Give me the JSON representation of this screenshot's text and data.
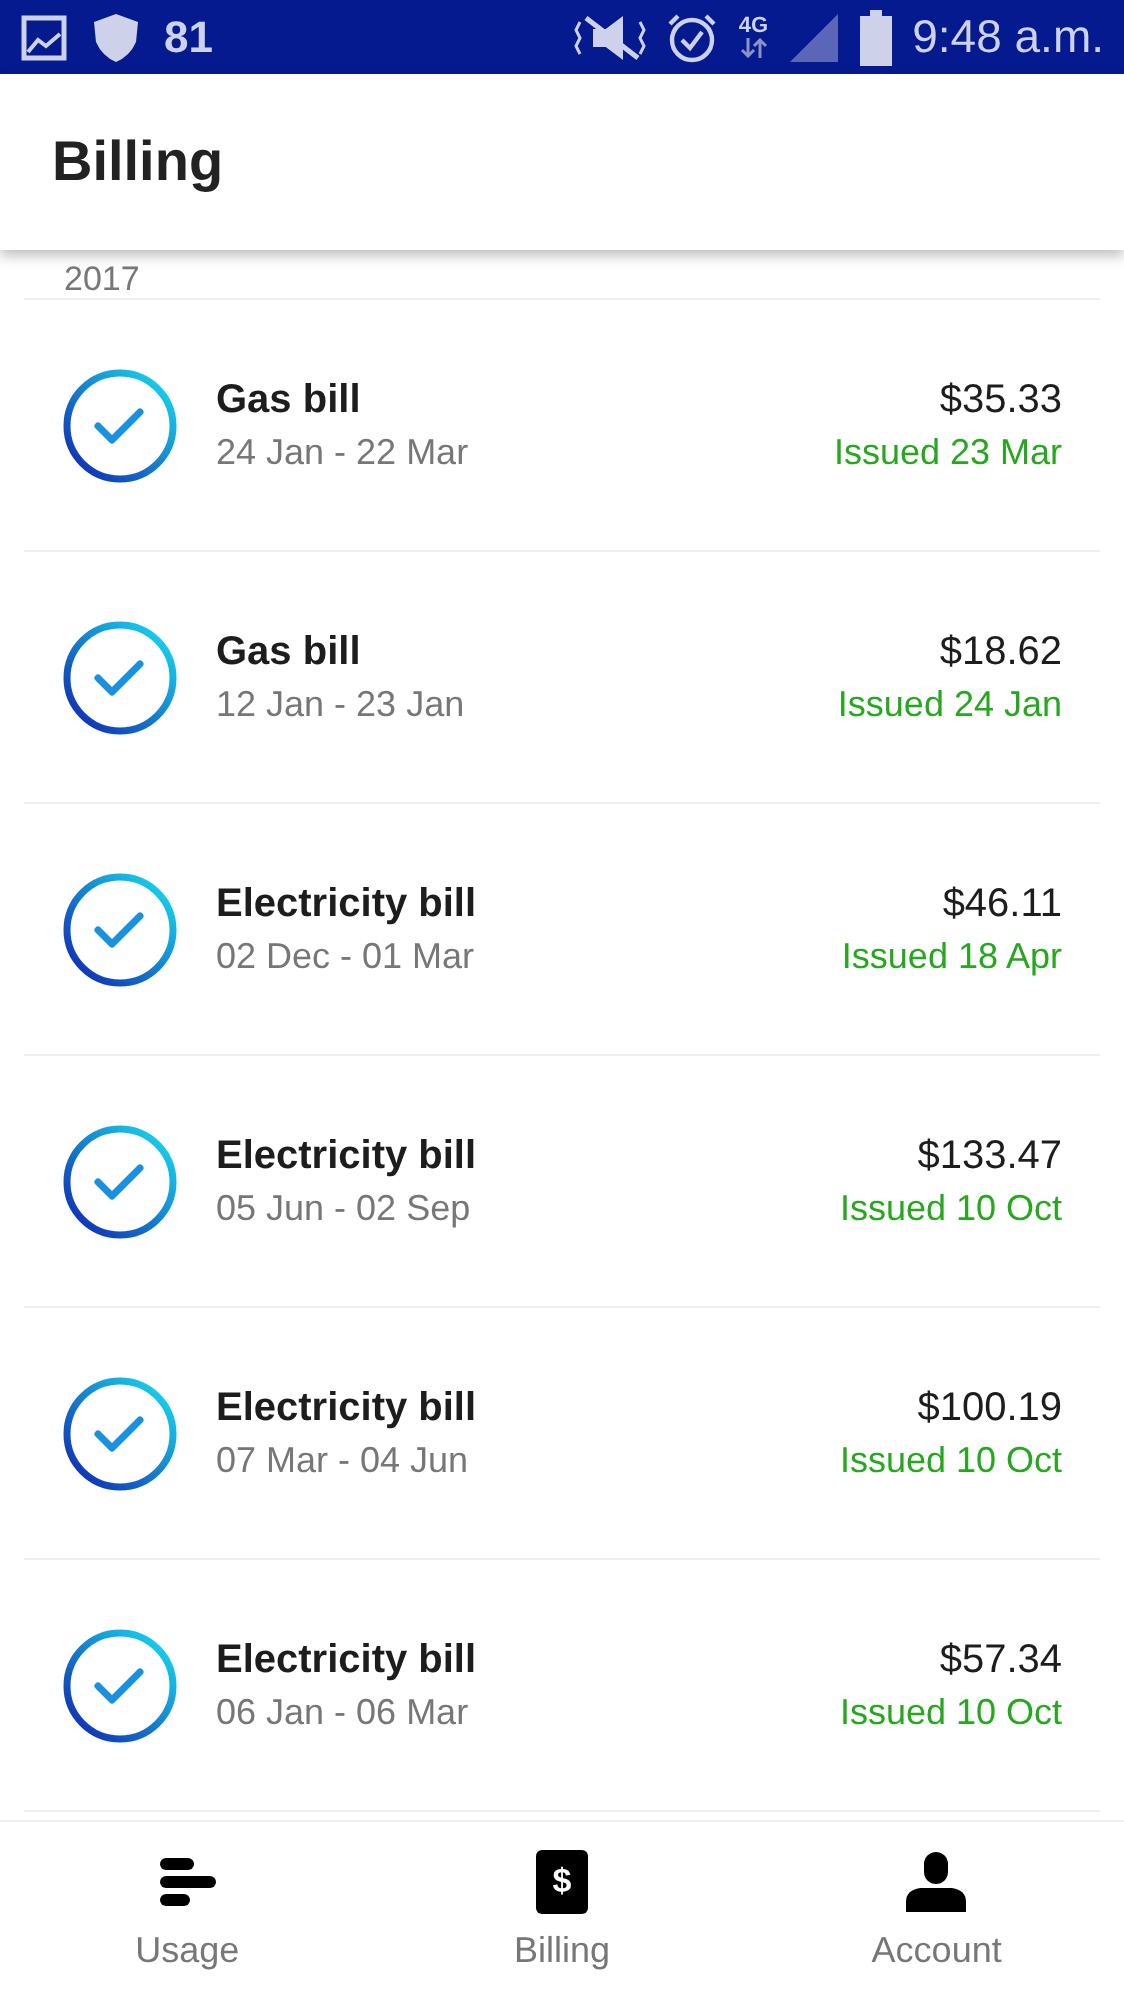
{
  "status_bar": {
    "notification_count": "81",
    "network": "4G",
    "time": "9:48 a.m."
  },
  "header": {
    "title": "Billing"
  },
  "year_label": "2017",
  "bills": [
    {
      "title": "Gas bill",
      "period": "24 Jan - 22 Mar",
      "amount": "$35.33",
      "issued": "Issued 23 Mar",
      "paid": true
    },
    {
      "title": "Gas bill",
      "period": "12 Jan - 23 Jan",
      "amount": "$18.62",
      "issued": "Issued 24 Jan",
      "paid": true
    },
    {
      "title": "Electricity bill",
      "period": "02 Dec - 01 Mar",
      "amount": "$46.11",
      "issued": "Issued 18 Apr",
      "paid": true
    },
    {
      "title": "Electricity bill",
      "period": "05 Jun - 02 Sep",
      "amount": "$133.47",
      "issued": "Issued 10 Oct",
      "paid": true
    },
    {
      "title": "Electricity bill",
      "period": "07 Mar - 04 Jun",
      "amount": "$100.19",
      "issued": "Issued 10 Oct",
      "paid": true
    },
    {
      "title": "Electricity bill",
      "period": "06 Jan - 06 Mar",
      "amount": "$57.34",
      "issued": "Issued 10 Oct",
      "paid": true
    }
  ],
  "nav": [
    {
      "kind": "usage",
      "label": "Usage"
    },
    {
      "kind": "billing",
      "label": "Billing",
      "glyph": "$"
    },
    {
      "kind": "account",
      "label": "Account"
    }
  ]
}
